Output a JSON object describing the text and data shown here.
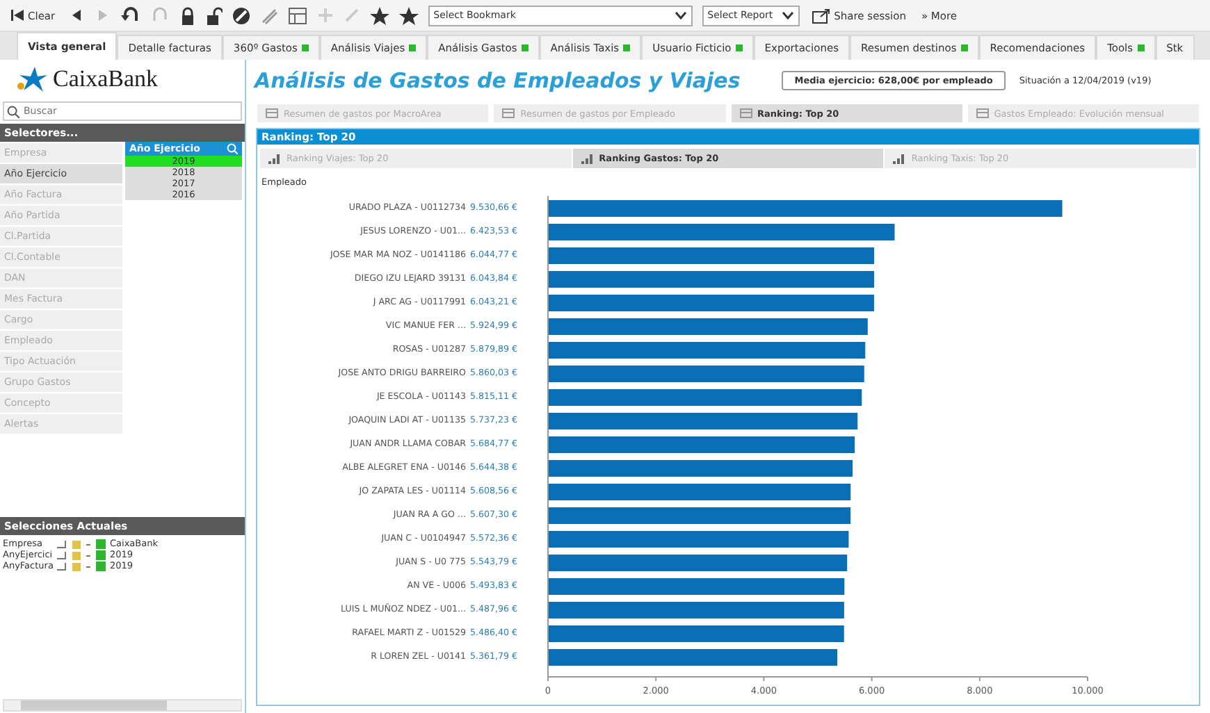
{
  "toolbar": {
    "clear": "Clear",
    "bookmark": "Select Bookmark",
    "report": "Select Report",
    "share": "Share session",
    "more": "» More"
  },
  "tabs": [
    {
      "label": "Vista general",
      "selected": true,
      "indicator": false
    },
    {
      "label": "Detalle facturas",
      "selected": false,
      "indicator": false
    },
    {
      "label": "360º Gastos",
      "selected": false,
      "indicator": true
    },
    {
      "label": "Análisis Viajes",
      "selected": false,
      "indicator": true
    },
    {
      "label": "Análisis Gastos",
      "selected": false,
      "indicator": true
    },
    {
      "label": "Análisis Taxis",
      "selected": false,
      "indicator": true
    },
    {
      "label": "Usuario Ficticio",
      "selected": false,
      "indicator": true
    },
    {
      "label": "Exportaciones",
      "selected": false,
      "indicator": false
    },
    {
      "label": "Resumen destinos",
      "selected": false,
      "indicator": true
    },
    {
      "label": "Recomendaciones",
      "selected": false,
      "indicator": false
    },
    {
      "label": "Tools",
      "selected": false,
      "indicator": true
    },
    {
      "label": "Stk",
      "selected": false,
      "indicator": false
    }
  ],
  "logo": "CaixaBank",
  "title": "Análisis de Gastos de Empleados y Viajes",
  "average": "Media ejercicio: 628,00€ por empleado",
  "status": "Situación a 12/04/2019 (v19)",
  "search": {
    "placeholder": "Buscar"
  },
  "selectors": {
    "title": "Selectores...",
    "items": [
      {
        "label": "Empresa",
        "selected": false
      },
      {
        "label": "Año Ejercicio",
        "selected": true
      },
      {
        "label": "Año Factura",
        "selected": false
      },
      {
        "label": "Año Partida",
        "selected": false
      },
      {
        "label": "Cl.Partida",
        "selected": false
      },
      {
        "label": "Cl.Contable",
        "selected": false
      },
      {
        "label": "DAN",
        "selected": false
      },
      {
        "label": "Mes Factura",
        "selected": false
      },
      {
        "label": "Cargo",
        "selected": false
      },
      {
        "label": "Empleado",
        "selected": false
      },
      {
        "label": "Tipo Actuación",
        "selected": false
      },
      {
        "label": "Grupo Gastos",
        "selected": false
      },
      {
        "label": "Concepto",
        "selected": false
      },
      {
        "label": "Alertas",
        "selected": false
      }
    ]
  },
  "listbox": {
    "title": "Año Ejercicio",
    "items": [
      {
        "label": "2019",
        "selected": true
      },
      {
        "label": "2018",
        "selected": false
      },
      {
        "label": "2017",
        "selected": false
      },
      {
        "label": "2016",
        "selected": false
      }
    ]
  },
  "current_selections": {
    "title": "Selecciones Actuales",
    "rows": [
      {
        "field": "Empresa",
        "value": "CaixaBank"
      },
      {
        "field": "AnyEjercici",
        "value": "2019"
      },
      {
        "field": "AnyFactura",
        "value": "2019"
      }
    ]
  },
  "report_tabs": [
    {
      "label": "Resumen de gastos por MacroArea",
      "selected": false
    },
    {
      "label": "Resumen de gastos por Empleado",
      "selected": false
    },
    {
      "label": "Ranking: Top 20",
      "selected": true
    },
    {
      "label": "Gastos Empleado: Evolución mensual",
      "selected": false
    }
  ],
  "panel_title": "Ranking: Top 20",
  "sub_tabs": [
    {
      "label": "Ranking Viajes: Top 20",
      "selected": false
    },
    {
      "label": "Ranking Gastos: Top 20",
      "selected": true
    },
    {
      "label": "Ranking Taxis: Top 20",
      "selected": false
    }
  ],
  "chart": {
    "column_label": "Empleado",
    "chart_data": {
      "type": "bar",
      "orientation": "horizontal",
      "categories": [
        "URADO PLAZA - U0112734",
        "JESUS LORENZO - U01...",
        "JOSE MAR MA NOZ - U0141186",
        "DIEGO IZU LEJARD 39131",
        "J ARC AG - U0117991",
        "VIC MANUE FER ...",
        "ROSAS - U01287",
        "JOSE ANTO DRIGU BARREIRO",
        "JE ESCOLA - U01143",
        "JOAQUIN LADI AT - U01135",
        "JUAN ANDR LLAMA COBAR",
        "ALBE ALEGRET ENA - U0146",
        "JO ZAPATA LES - U01114",
        "JUAN RA A GO ...",
        "JUAN C - U0104947",
        "JUAN S - U0 775",
        "AN VE - U006",
        "LUIS L MUÑOZ NDEZ - U01...",
        "RAFAEL MARTI Z - U01529",
        "R LOREN ZEL - U0141"
      ],
      "values": [
        9530.66,
        6423.53,
        6044.77,
        6043.84,
        6043.21,
        5924.99,
        5879.89,
        5860.03,
        5815.11,
        5737.23,
        5684.77,
        5644.38,
        5608.56,
        5607.3,
        5572.36,
        5543.79,
        5493.83,
        5487.96,
        5486.4,
        5361.79
      ],
      "value_labels": [
        "9.530,66 €",
        "6.423,53 €",
        "6.044,77 €",
        "6.043,84 €",
        "6.043,21 €",
        "5.924,99 €",
        "5.879,89 €",
        "5.860,03 €",
        "5.815,11 €",
        "5.737,23 €",
        "5.684,77 €",
        "5.644,38 €",
        "5.608,56 €",
        "5.607,30 €",
        "5.572,36 €",
        "5.543,79 €",
        "5.493,83 €",
        "5.487,96 €",
        "5.486,40 €",
        "5.361,79 €"
      ],
      "xlim": [
        0,
        10000
      ],
      "xticks": [
        {
          "value": 0,
          "label": "0"
        },
        {
          "value": 2000,
          "label": "2.000"
        },
        {
          "value": 4000,
          "label": "4.000"
        },
        {
          "value": 6000,
          "label": "6.000"
        },
        {
          "value": 8000,
          "label": "8.000"
        },
        {
          "value": 10000,
          "label": "10.000"
        }
      ]
    }
  }
}
